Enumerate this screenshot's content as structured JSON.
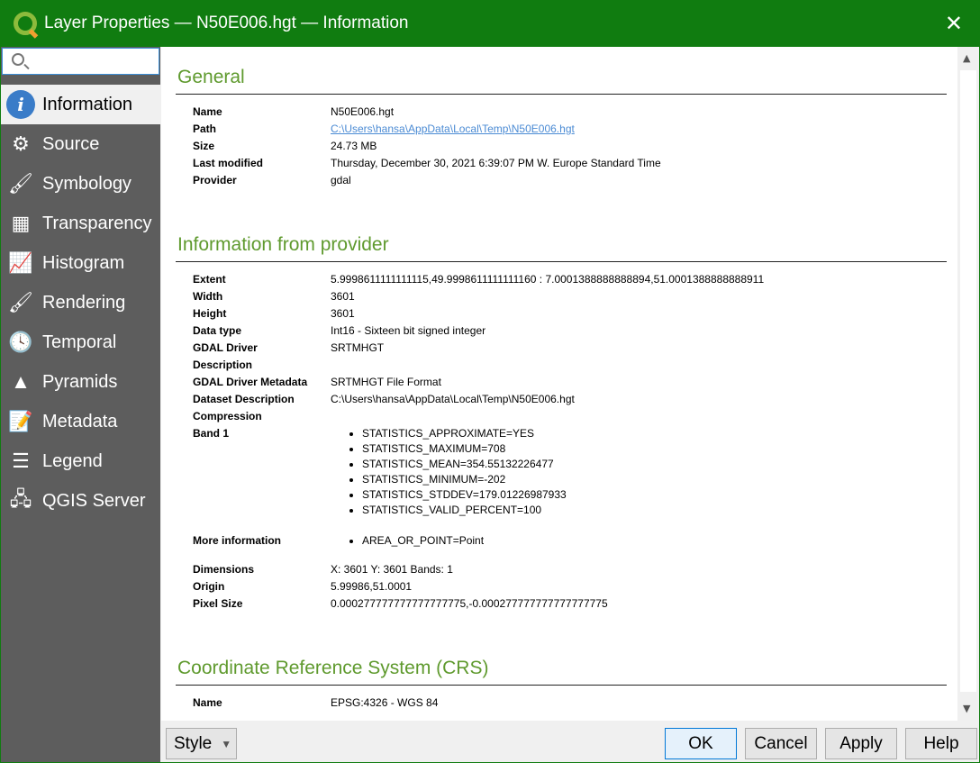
{
  "window": {
    "title": "Layer Properties — N50E006.hgt — Information",
    "accent": "#107c10"
  },
  "search": {
    "placeholder": ""
  },
  "sidebar": {
    "items": [
      {
        "label": "Information",
        "icon": "info-icon",
        "glyph": "i"
      },
      {
        "label": "Source",
        "icon": "gears-icon",
        "glyph": "⚙"
      },
      {
        "label": "Symbology",
        "icon": "paintbrush-icon",
        "glyph": "🖌"
      },
      {
        "label": "Transparency",
        "icon": "transparency-icon",
        "glyph": "▦"
      },
      {
        "label": "Histogram",
        "icon": "histogram-icon",
        "glyph": "📈"
      },
      {
        "label": "Rendering",
        "icon": "brush-icon",
        "glyph": "🖌"
      },
      {
        "label": "Temporal",
        "icon": "clock-icon",
        "glyph": "🕓"
      },
      {
        "label": "Pyramids",
        "icon": "pyramid-icon",
        "glyph": "▲"
      },
      {
        "label": "Metadata",
        "icon": "document-icon",
        "glyph": "📝"
      },
      {
        "label": "Legend",
        "icon": "legend-icon",
        "glyph": "☰"
      },
      {
        "label": "QGIS Server",
        "icon": "server-icon",
        "glyph": "🖧"
      }
    ]
  },
  "general": {
    "title": "General",
    "rows": [
      {
        "k": "Name",
        "v": "N50E006.hgt"
      },
      {
        "k": "Path",
        "v": "C:\\Users\\hansa\\AppData\\Local\\Temp\\N50E006.hgt",
        "link": true
      },
      {
        "k": "Size",
        "v": "24.73 MB"
      },
      {
        "k": "Last modified",
        "v": "Thursday, December 30, 2021 6:39:07 PM W. Europe Standard Time"
      },
      {
        "k": "Provider",
        "v": "gdal"
      }
    ]
  },
  "provider": {
    "title": "Information from provider",
    "rows": [
      {
        "k": "Extent",
        "v": "5.9998611111111115,49.9998611111111160 : 7.0001388888888894,51.0001388888888911"
      },
      {
        "k": "Width",
        "v": "3601"
      },
      {
        "k": "Height",
        "v": "3601"
      },
      {
        "k": "Data type",
        "v": "Int16 - Sixteen bit signed integer"
      },
      {
        "k": "GDAL Driver Description",
        "v": "SRTMHGT"
      },
      {
        "k": "GDAL Driver Metadata",
        "v": "SRTMHGT File Format"
      },
      {
        "k": "Dataset Description",
        "v": "C:\\Users\\hansa\\AppData\\Local\\Temp\\N50E006.hgt"
      },
      {
        "k": "Compression",
        "v": ""
      }
    ],
    "band1_label": "Band 1",
    "band1": [
      "STATISTICS_APPROXIMATE=YES",
      "STATISTICS_MAXIMUM=708",
      "STATISTICS_MEAN=354.55132226477",
      "STATISTICS_MINIMUM=-202",
      "STATISTICS_STDDEV=179.01226987933",
      "STATISTICS_VALID_PERCENT=100"
    ],
    "more_label": "More information",
    "more": [
      "AREA_OR_POINT=Point"
    ],
    "rows2": [
      {
        "k": "Dimensions",
        "v": "X: 3601 Y: 3601 Bands: 1"
      },
      {
        "k": "Origin",
        "v": "5.99986,51.0001"
      },
      {
        "k": "Pixel Size",
        "v": "0.000277777777777777775,-0.000277777777777777775"
      }
    ]
  },
  "crs": {
    "title": "Coordinate Reference System (CRS)",
    "rows": [
      {
        "k": "Name",
        "v": "EPSG:4326 - WGS 84"
      }
    ]
  },
  "buttons": {
    "style": "Style",
    "ok": "OK",
    "cancel": "Cancel",
    "apply": "Apply",
    "help": "Help"
  }
}
